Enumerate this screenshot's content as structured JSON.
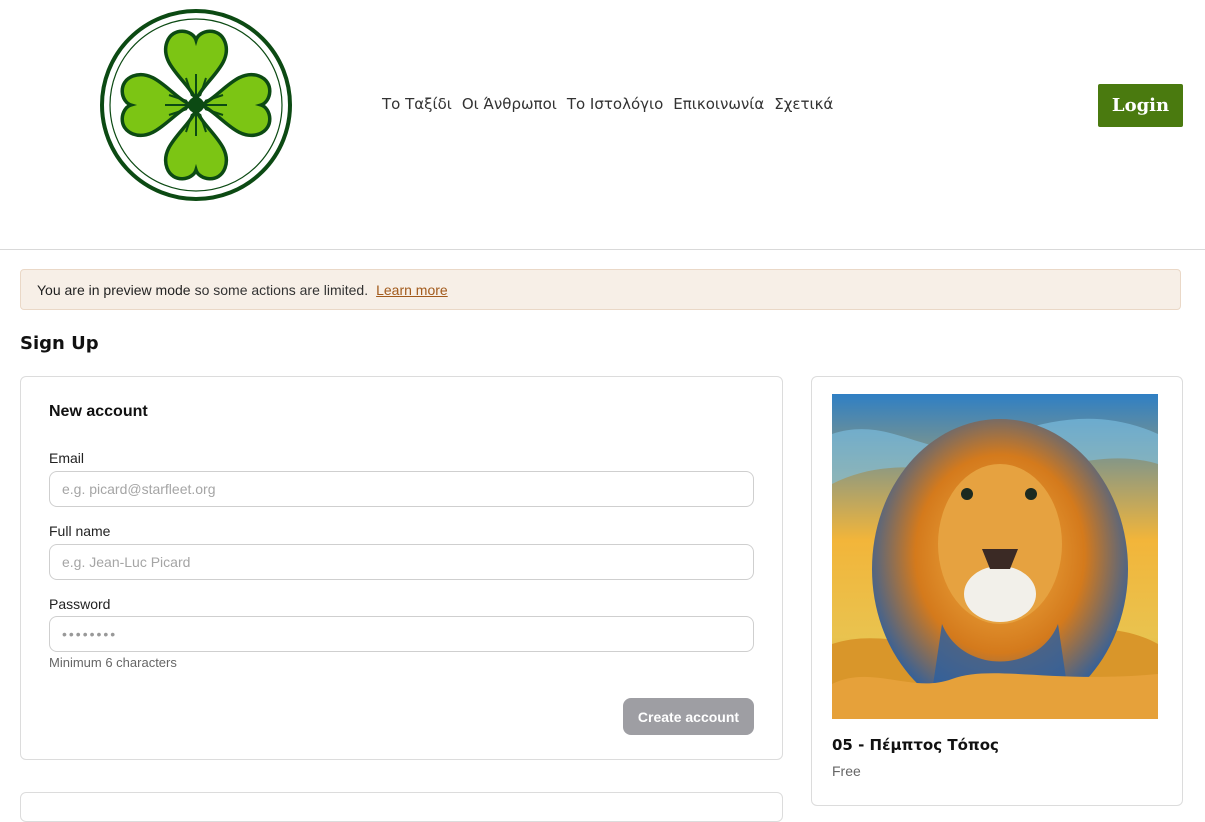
{
  "header": {
    "logo_icon": "four-leaf-clover-icon",
    "nav": [
      {
        "label": "Το Ταξίδι"
      },
      {
        "label": "Οι Άνθρωποι"
      },
      {
        "label": "Το Ιστολόγιο"
      },
      {
        "label": "Επικοινωνία"
      },
      {
        "label": "Σχετικά"
      }
    ],
    "login_label": "Login",
    "colors": {
      "login_bg": "#4a7a0f",
      "clover_green": "#7cc514",
      "clover_dark": "#0c4a13"
    }
  },
  "banner": {
    "prefix": "You are in preview mode",
    "suffix": "so some actions are limited.",
    "link": "Learn more",
    "colors": {
      "bg": "#f7efe7",
      "link": "#a25a1c"
    }
  },
  "page": {
    "title": "Sign Up"
  },
  "form": {
    "title": "New account",
    "email_label": "Email",
    "email_placeholder": "e.g. picard@starfleet.org",
    "email_value": "",
    "name_label": "Full name",
    "name_placeholder": "e.g. Jean-Luc Picard",
    "name_value": "",
    "password_label": "Password",
    "password_value": "••••••••",
    "password_hint": "Minimum 6 characters",
    "submit_label": "Create account",
    "colors": {
      "submit_bg": "#9e9ea3"
    }
  },
  "product": {
    "image_icon": "lion-painting",
    "title": "05 - Πέμπτος Τόπος",
    "price": "Free"
  }
}
